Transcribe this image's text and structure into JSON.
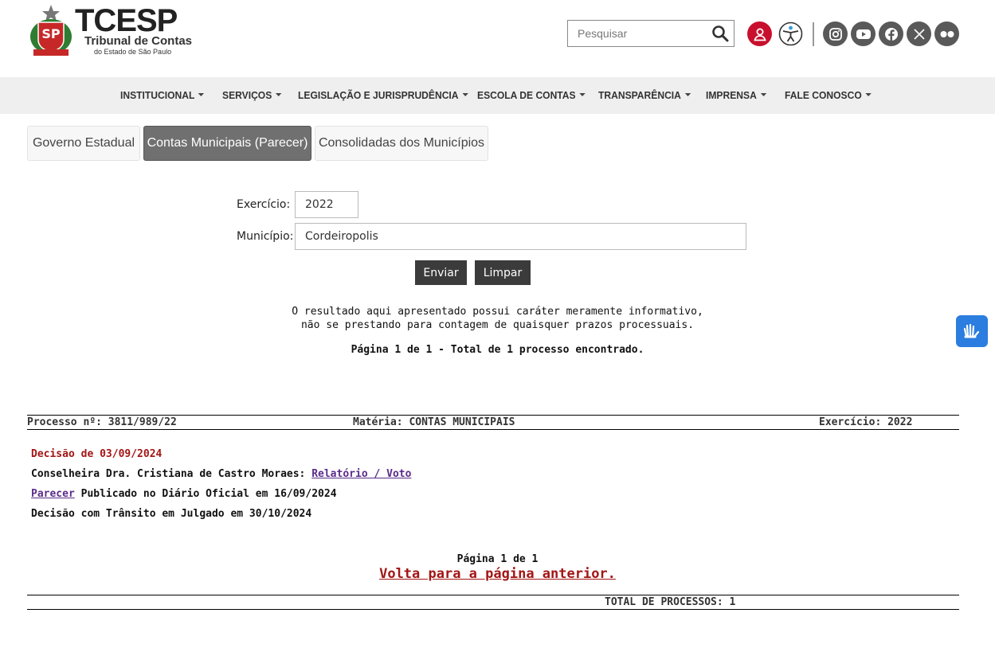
{
  "brand": {
    "logo_text": "TCESP",
    "logo_subtitle": "Tribunal de Contas",
    "logo_subtitle2": "do Estado de São Paulo",
    "crest_lettering": "SP"
  },
  "search": {
    "placeholder": "Pesquisar"
  },
  "header_icons": [
    "user-icon",
    "accessibility-icon",
    "instagram-icon",
    "youtube-icon",
    "facebook-icon",
    "x-icon",
    "flickr-icon"
  ],
  "nav": {
    "items": [
      {
        "label": "INSTITUCIONAL"
      },
      {
        "label": "SERVIÇOS"
      },
      {
        "label": "LEGISLAÇÃO E JURISPRUDÊNCIA"
      },
      {
        "label": "ESCOLA DE CONTAS"
      },
      {
        "label": "TRANSPARÊNCIA"
      },
      {
        "label": "IMPRENSA"
      },
      {
        "label": "FALE CONOSCO"
      }
    ]
  },
  "tabs": [
    {
      "label": "Governo Estadual",
      "active": false
    },
    {
      "label": "Contas Municipais (Parecer)",
      "active": true
    },
    {
      "label": "Consolidadas dos Municípios",
      "active": false
    }
  ],
  "form": {
    "exercicio_label": "Exercício:",
    "exercicio_value": "2022",
    "municipio_label": "Município:",
    "municipio_value": "Cordeiropolis",
    "submit_label": "Enviar",
    "clear_label": "Limpar"
  },
  "disclaimer": {
    "line1": "O resultado aqui apresentado possui caráter meramente informativo,",
    "line2": "não se prestando para contagem de quaisquer prazos processuais."
  },
  "pagination_top": "Página 1 de 1 - Total de 1 processo encontrado.",
  "process": {
    "number": "Processo nº: 3811/989/22",
    "materia": "Matéria: CONTAS MUNICIPAIS",
    "exercicio": "Exercício: 2022"
  },
  "decision": {
    "date": "Decisão de 03/09/2024",
    "councillor": "Conselheira Dra. Cristiana de Castro Moraes:",
    "report_link": "Relatório / Voto",
    "parecer_link": "Parecer",
    "published": "Publicado no Diário Oficial em 16/09/2024",
    "transit": "Decisão com Trânsito em Julgado em 30/10/2024"
  },
  "pagination_bottom": "Página 1 de 1",
  "back_link": "Volta para a página anterior.",
  "total": "TOTAL DE PROCESSOS: 1",
  "colors": {
    "accent_red": "#a31515",
    "link_purple": "#5b2c8a",
    "active_tab": "#707070",
    "button": "#3b3b3b",
    "libras_blue": "#2b7de0",
    "user_red": "#c8102e"
  }
}
